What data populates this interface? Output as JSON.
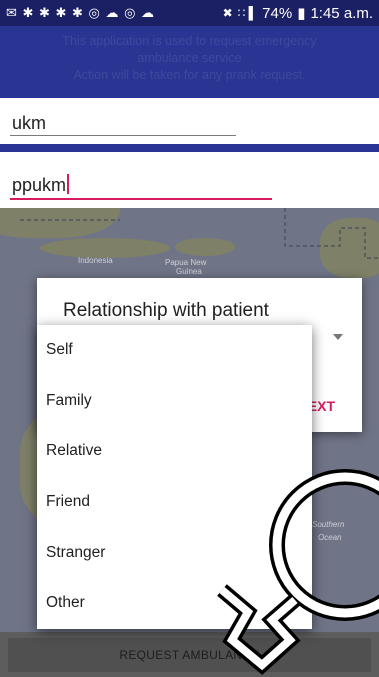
{
  "status_bar": {
    "notification_icons": "✉ ✱ ✱ ✱ ✱ ◎ ☁ ◎ ☁",
    "mute_icon": "✖",
    "signal_icon": "∷ ▌",
    "battery": "74%",
    "battery_icon": "▮",
    "time": "1:45 a.m."
  },
  "banner": {
    "line1": "This application is used to request emergency",
    "line2": "ambulance service",
    "line3": "Action will be taken for any prank request."
  },
  "fields": {
    "field1_value": "ukm",
    "field2_value": "ppukm"
  },
  "map": {
    "label_indonesia": "Indonesia",
    "label_png_1": "Papua New",
    "label_png_2": "Guinea",
    "label_ocean_1": "Southern",
    "label_ocean_2": "Ocean"
  },
  "dialog": {
    "title": "Relationship with patient",
    "next_label": "EXT"
  },
  "relationship_options": {
    "items": [
      "Self",
      "Family",
      "Relative",
      "Friend",
      "Stranger",
      "Other"
    ]
  },
  "bottom": {
    "request_label": "REQUEST AMBULANCE"
  },
  "colors": {
    "status_bar": "#1b1f63",
    "banner": "#283593",
    "accent": "#d81b60",
    "map_dim": "#6f7487"
  }
}
